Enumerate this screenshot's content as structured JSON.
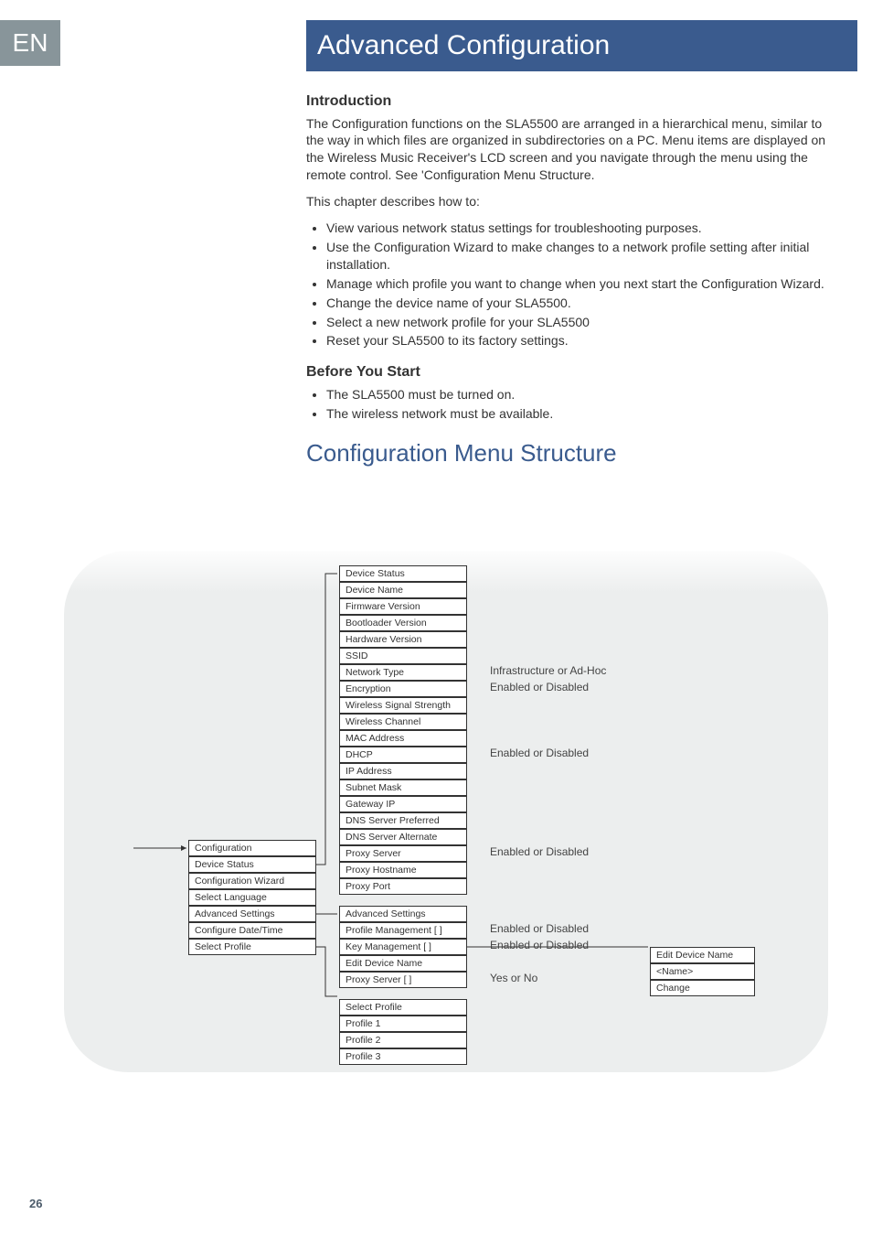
{
  "lang_tab": "EN",
  "banner": "Advanced Configuration",
  "intro": {
    "heading": "Introduction",
    "para1": "The Configuration functions on the SLA5500 are arranged in a hierarchical menu, similar to the way in which files are organized in subdirectories on a PC. Menu items are displayed on the Wireless Music Receiver's LCD screen and you navigate through the menu using the remote control. See 'Configuration Menu Structure.",
    "para2": "This chapter describes how to:",
    "bullets": [
      "View various network status settings for troubleshooting purposes.",
      "Use the Configuration Wizard to make changes to a network profile setting after initial installation.",
      "Manage which profile you want to change when you next start the Configuration Wizard.",
      "Change the device name of your SLA5500.",
      "Select a new network profile for your SLA5500",
      "Reset your SLA5500 to its factory settings."
    ]
  },
  "before": {
    "heading": "Before You Start",
    "bullets": [
      "The SLA5500 must be turned on.",
      "The wireless network must be available."
    ]
  },
  "cms_heading": "Configuration Menu Structure",
  "col1": [
    "Configuration",
    "Device Status",
    "Configuration Wizard",
    "Select Language",
    "Advanced Settings",
    "Configure Date/Time",
    "Select Profile"
  ],
  "col2_device_status": [
    "Device Status",
    "Device Name",
    "Firmware Version",
    "Bootloader Version",
    "Hardware Version",
    "SSID",
    "Network Type",
    "Encryption",
    "Wireless Signal Strength",
    "Wireless Channel",
    "MAC Address",
    "DHCP",
    "IP Address",
    "Subnet Mask",
    "Gateway IP",
    "DNS Server Preferred",
    "DNS Server Alternate",
    "Proxy Server",
    "Proxy Hostname",
    "Proxy Port"
  ],
  "col2_advanced": [
    "Advanced Settings",
    "Profile Management [ ]",
    "Key Management [ ]",
    "Edit Device Name",
    "Proxy Server [ ]"
  ],
  "col2_select_profile": [
    "Select Profile",
    "Profile 1",
    "Profile 2",
    "Profile 3"
  ],
  "labels": {
    "network_type": "Infrastructure or Ad-Hoc",
    "encryption": "Enabled or Disabled",
    "dhcp": "Enabled or Disabled",
    "proxy_server": "Enabled or Disabled",
    "profile_mgmt": "Enabled or Disabled",
    "key_mgmt": "Enabled or Disabled",
    "proxy_server2": "Yes or No"
  },
  "col4": [
    "Edit Device Name",
    "<Name>",
    "Change"
  ],
  "page_number": "26"
}
